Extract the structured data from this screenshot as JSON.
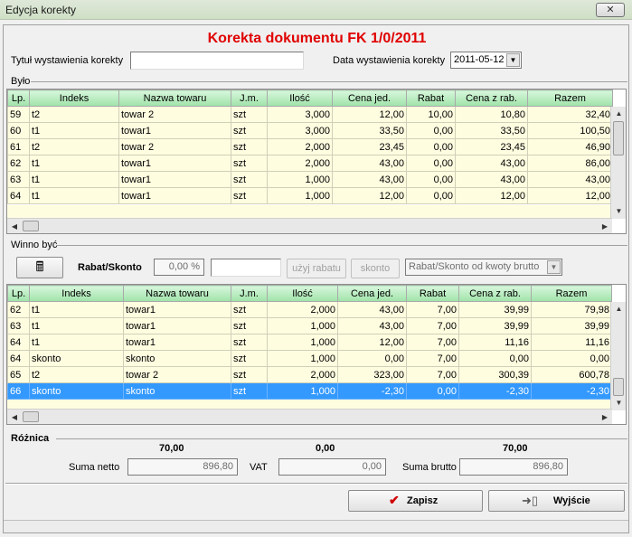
{
  "window": {
    "title": "Edycja korekty",
    "close_glyph": "✕"
  },
  "header": {
    "doc_title": "Korekta dokumentu FK 1/0/2011",
    "title_label": "Tytuł wystawienia korekty",
    "title_value": "",
    "date_label": "Data wystawienia korekty",
    "date_value": "2011-05-12"
  },
  "bylo": {
    "label": "Było",
    "columns": [
      "Lp.",
      "Indeks",
      "Nazwa towaru",
      "J.m.",
      "Ilość",
      "Cena jed.",
      "Rabat",
      "Cena z rab.",
      "Razem"
    ],
    "rows": [
      [
        "59",
        "t2",
        "towar 2",
        "szt",
        "3,000",
        "12,00",
        "10,00",
        "10,80",
        "32,40"
      ],
      [
        "60",
        "t1",
        "towar1",
        "szt",
        "3,000",
        "33,50",
        "0,00",
        "33,50",
        "100,50"
      ],
      [
        "61",
        "t2",
        "towar 2",
        "szt",
        "2,000",
        "23,45",
        "0,00",
        "23,45",
        "46,90"
      ],
      [
        "62",
        "t1",
        "towar1",
        "szt",
        "2,000",
        "43,00",
        "0,00",
        "43,00",
        "86,00"
      ],
      [
        "63",
        "t1",
        "towar1",
        "szt",
        "1,000",
        "43,00",
        "0,00",
        "43,00",
        "43,00"
      ],
      [
        "64",
        "t1",
        "towar1",
        "szt",
        "1,000",
        "12,00",
        "0,00",
        "12,00",
        "12,00"
      ]
    ]
  },
  "winno": {
    "label": "Winno być",
    "rabat_label": "Rabat/Skonto",
    "rabat_pct": "0,00 %",
    "rabat_value": "",
    "apply_label": "użyj rabatu",
    "skonto_label": "skonto",
    "mode_value": "Rabat/Skonto od kwoty brutto",
    "columns": [
      "Lp.",
      "Indeks",
      "Nazwa towaru",
      "J.m.",
      "Ilość",
      "Cena jed.",
      "Rabat",
      "Cena z rab.",
      "Razem"
    ],
    "rows": [
      [
        "62",
        "t1",
        "towar1",
        "szt",
        "2,000",
        "43,00",
        "7,00",
        "39,99",
        "79,98"
      ],
      [
        "63",
        "t1",
        "towar1",
        "szt",
        "1,000",
        "43,00",
        "7,00",
        "39,99",
        "39,99"
      ],
      [
        "64",
        "t1",
        "towar1",
        "szt",
        "1,000",
        "12,00",
        "7,00",
        "11,16",
        "11,16"
      ],
      [
        "64",
        "skonto",
        "skonto",
        "szt",
        "1,000",
        "0,00",
        "7,00",
        "0,00",
        "0,00"
      ],
      [
        "65",
        "t2",
        "towar 2",
        "szt",
        "2,000",
        "323,00",
        "7,00",
        "300,39",
        "600,78"
      ],
      [
        "66",
        "skonto",
        "skonto",
        "szt",
        "1,000",
        "-2,30",
        "0,00",
        "-2,30",
        "-2,30"
      ]
    ],
    "selected_row": 5
  },
  "roznica": {
    "label": "Różnica",
    "netto_diff": "70,00",
    "vat_diff": "0,00",
    "brutto_diff": "70,00",
    "netto_label": "Suma netto",
    "netto_value": "896,80",
    "vat_label": "VAT",
    "vat_value": "0,00",
    "brutto_label": "Suma brutto",
    "brutto_value": "896,80"
  },
  "buttons": {
    "save_label": "Zapisz",
    "exit_label": "Wyjście"
  },
  "colors": {
    "header_green": "#9fe3a9",
    "row_yellow": "#fffde0",
    "selection_blue": "#3399ff",
    "title_red": "#e00000"
  }
}
